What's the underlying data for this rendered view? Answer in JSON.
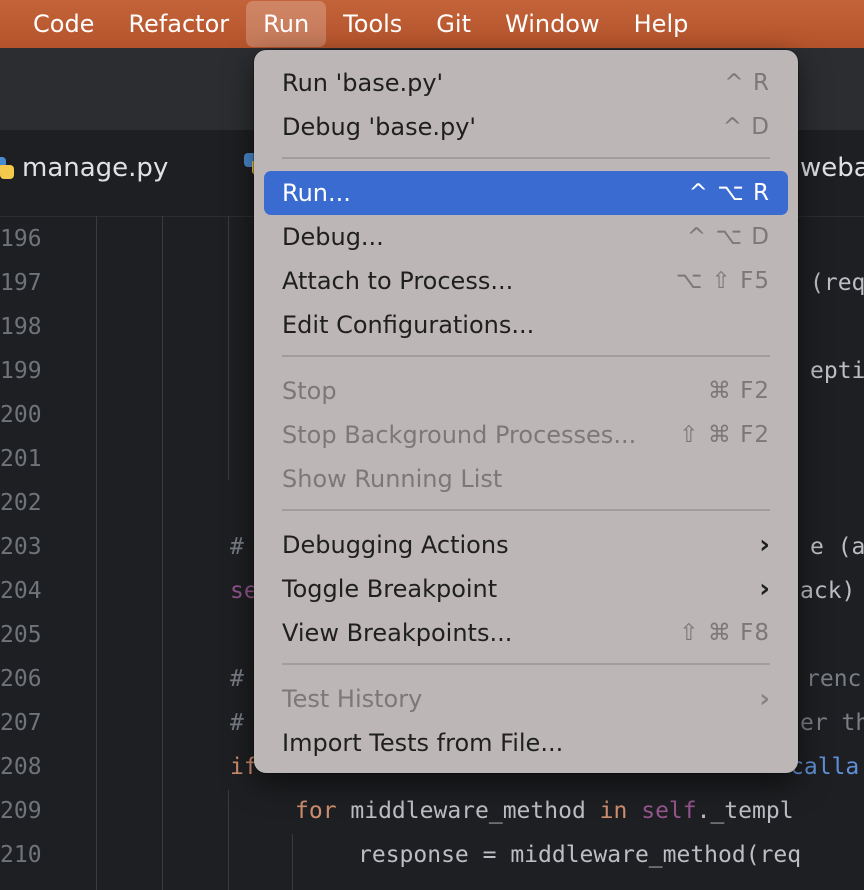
{
  "menubar": {
    "items": [
      "Code",
      "Refactor",
      "Run",
      "Tools",
      "Git",
      "Window",
      "Help"
    ]
  },
  "tabs": {
    "left": "manage.py",
    "right": "weba"
  },
  "editor": {
    "line_numbers": [
      "196",
      "197",
      "198",
      "199",
      "200",
      "201",
      "202",
      "203",
      "204",
      "205",
      "206",
      "207",
      "208",
      "209",
      "210"
    ],
    "fragments": {
      "l197": "(requ",
      "l199": "eptic",
      "l203_hash": "#",
      "l203_tail": "e (a",
      "l204_kw": "se",
      "l204_tail": "ack)",
      "l206_hash": "#",
      "l206_tail": "renc",
      "l207_hash": "#",
      "l207_tail": "er th",
      "l208_kw": "if",
      "l208_tail": "calla",
      "l209_for": "for",
      "l209_a": " middleware_method ",
      "l209_in": "in",
      "l209_self": "self",
      "l209_b": "._templ",
      "l210": "response = middleware_method(req"
    }
  },
  "run_menu": {
    "items": {
      "run_base": {
        "label": "Run 'base.py'",
        "shortcut": "^ R"
      },
      "debug_base": {
        "label": "Debug 'base.py'",
        "shortcut": "^ D"
      },
      "run": {
        "label": "Run...",
        "shortcut": "^ ⌥ R"
      },
      "debug": {
        "label": "Debug...",
        "shortcut": "^ ⌥ D"
      },
      "attach": {
        "label": "Attach to Process...",
        "shortcut": "⌥ ⇧ F5"
      },
      "edit_config": {
        "label": "Edit Configurations...",
        "shortcut": ""
      },
      "stop": {
        "label": "Stop",
        "shortcut": "⌘ F2"
      },
      "stop_bg": {
        "label": "Stop Background Processes...",
        "shortcut": "⇧ ⌘ F2"
      },
      "show_running": {
        "label": "Show Running List",
        "shortcut": ""
      },
      "debugging_actions": {
        "label": "Debugging Actions",
        "shortcut": ""
      },
      "toggle_breakpoint": {
        "label": "Toggle Breakpoint",
        "shortcut": ""
      },
      "view_breakpoints": {
        "label": "View Breakpoints...",
        "shortcut": "⇧ ⌘ F8"
      },
      "test_history": {
        "label": "Test History",
        "shortcut": ""
      },
      "import_tests": {
        "label": "Import Tests from File...",
        "shortcut": ""
      }
    }
  },
  "colors": {
    "menubar": "#b95a30",
    "highlight": "#3a6bd0",
    "editor_bg": "#1e1f22"
  }
}
